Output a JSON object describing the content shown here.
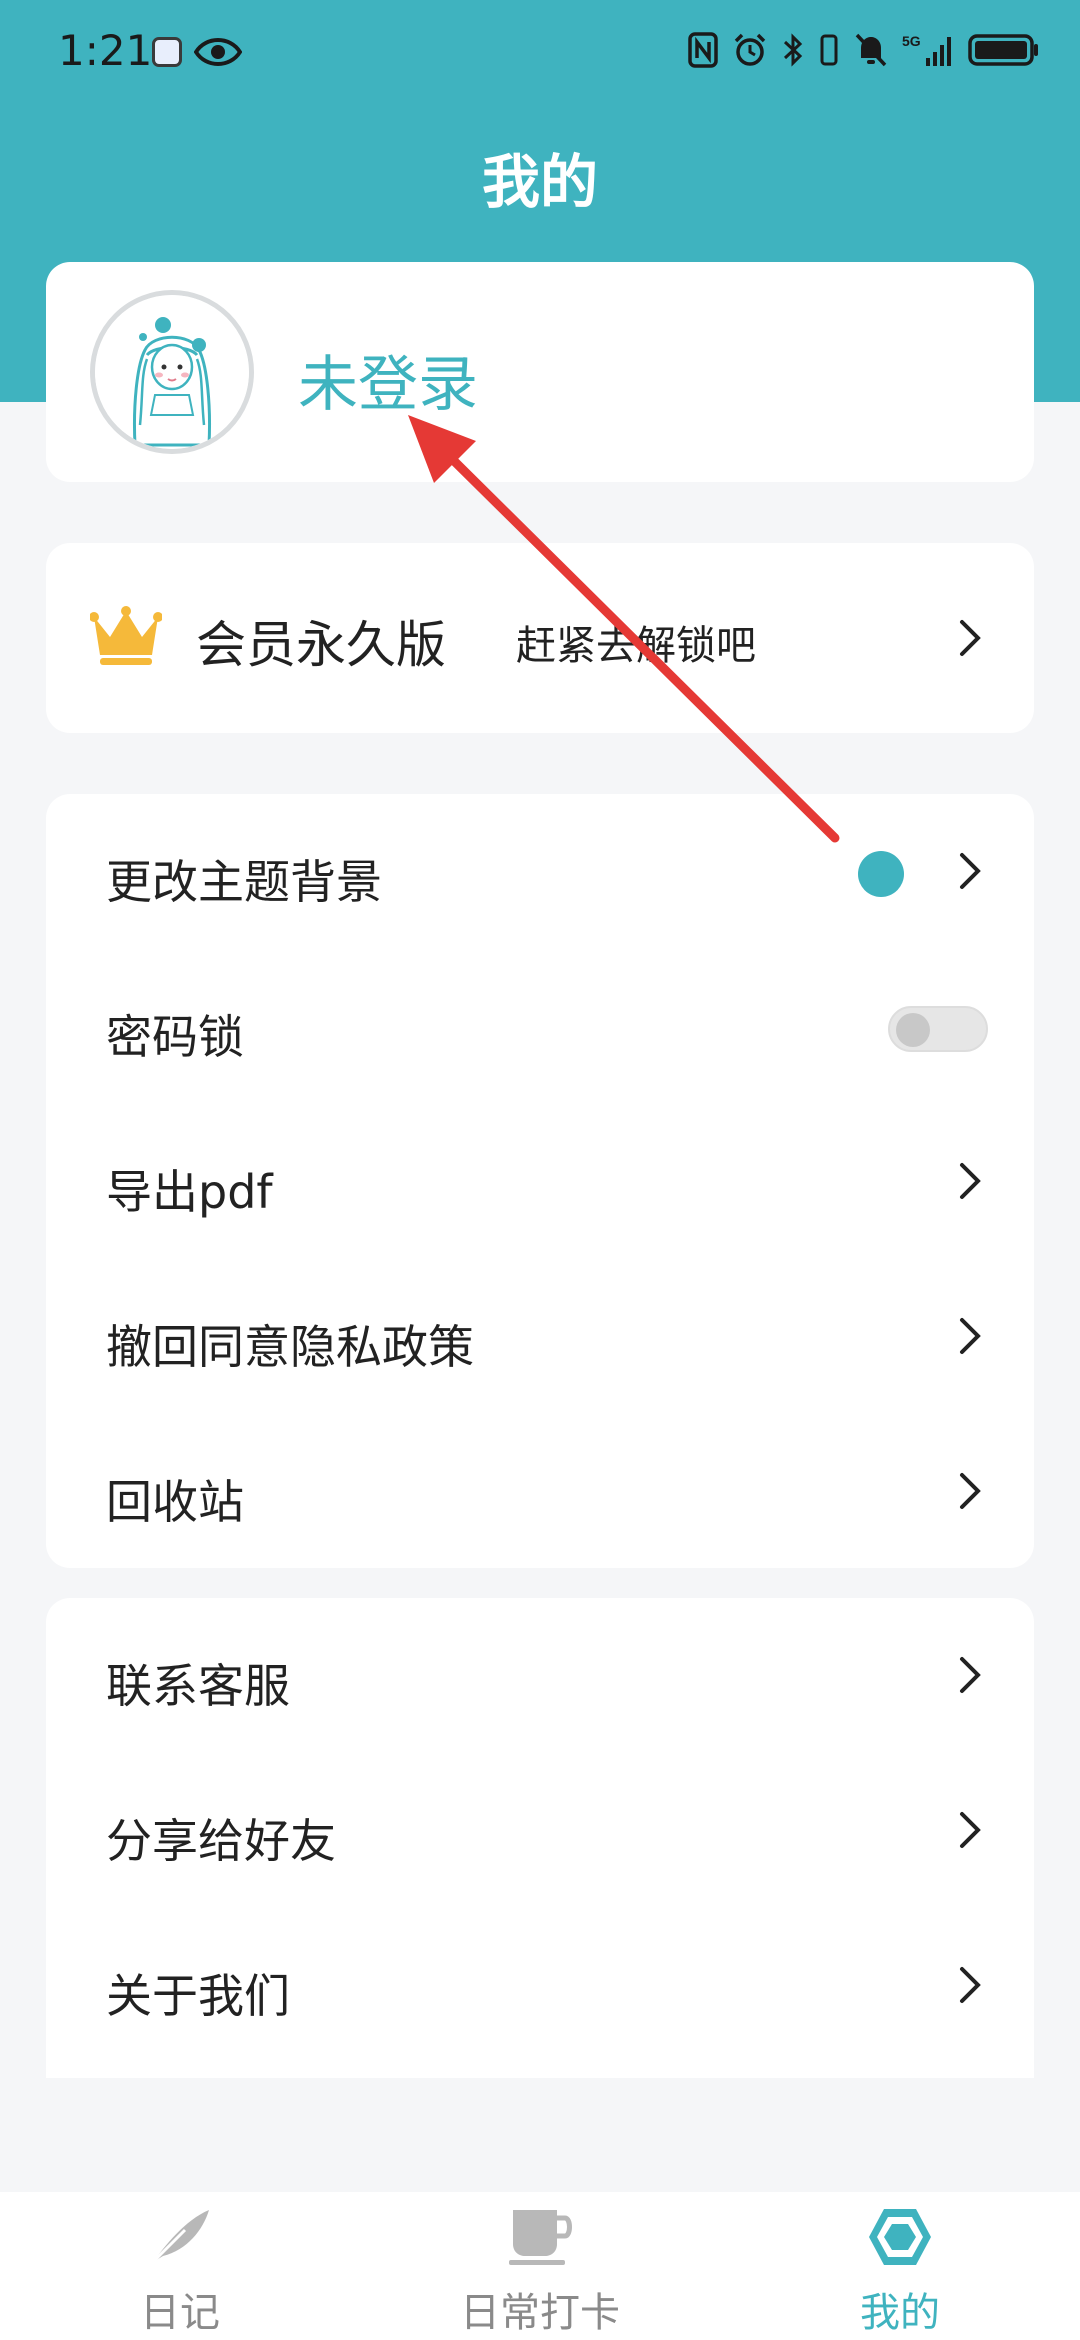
{
  "status_bar": {
    "time": "1:21",
    "icons": [
      "app-notification-icon",
      "eye-icon",
      "nfc-icon",
      "alarm-icon",
      "bluetooth-icon",
      "vibrate-icon",
      "mute-icon",
      "signal-5g-icon",
      "battery-icon"
    ],
    "network": "5G"
  },
  "header": {
    "title": "我的"
  },
  "profile": {
    "status": "未登录",
    "avatar_icon": "girl-avatar-icon"
  },
  "vip": {
    "title": "会员永久版",
    "subtitle": "赶紧去解锁吧",
    "icon": "crown-icon"
  },
  "settings": {
    "items": [
      {
        "label": "更改主题背景",
        "control": "chevron",
        "theme_color": "#3fb3bf"
      },
      {
        "label": "密码锁",
        "control": "toggle",
        "enabled": false
      },
      {
        "label": "导出pdf",
        "control": "chevron"
      },
      {
        "label": "撤回同意隐私政策",
        "control": "chevron"
      },
      {
        "label": "回收站",
        "control": "chevron"
      }
    ]
  },
  "menu": {
    "items": [
      {
        "label": "联系客服"
      },
      {
        "label": "分享给好友"
      },
      {
        "label": "关于我们"
      }
    ]
  },
  "bottom_nav": {
    "items": [
      {
        "label": "日记",
        "icon": "feather-icon",
        "active": false
      },
      {
        "label": "日常打卡",
        "icon": "cup-icon",
        "active": false
      },
      {
        "label": "我的",
        "icon": "hexagon-icon",
        "active": true
      }
    ]
  },
  "colors": {
    "accent": "#3fb3bf",
    "annotation_arrow": "#e53935"
  }
}
